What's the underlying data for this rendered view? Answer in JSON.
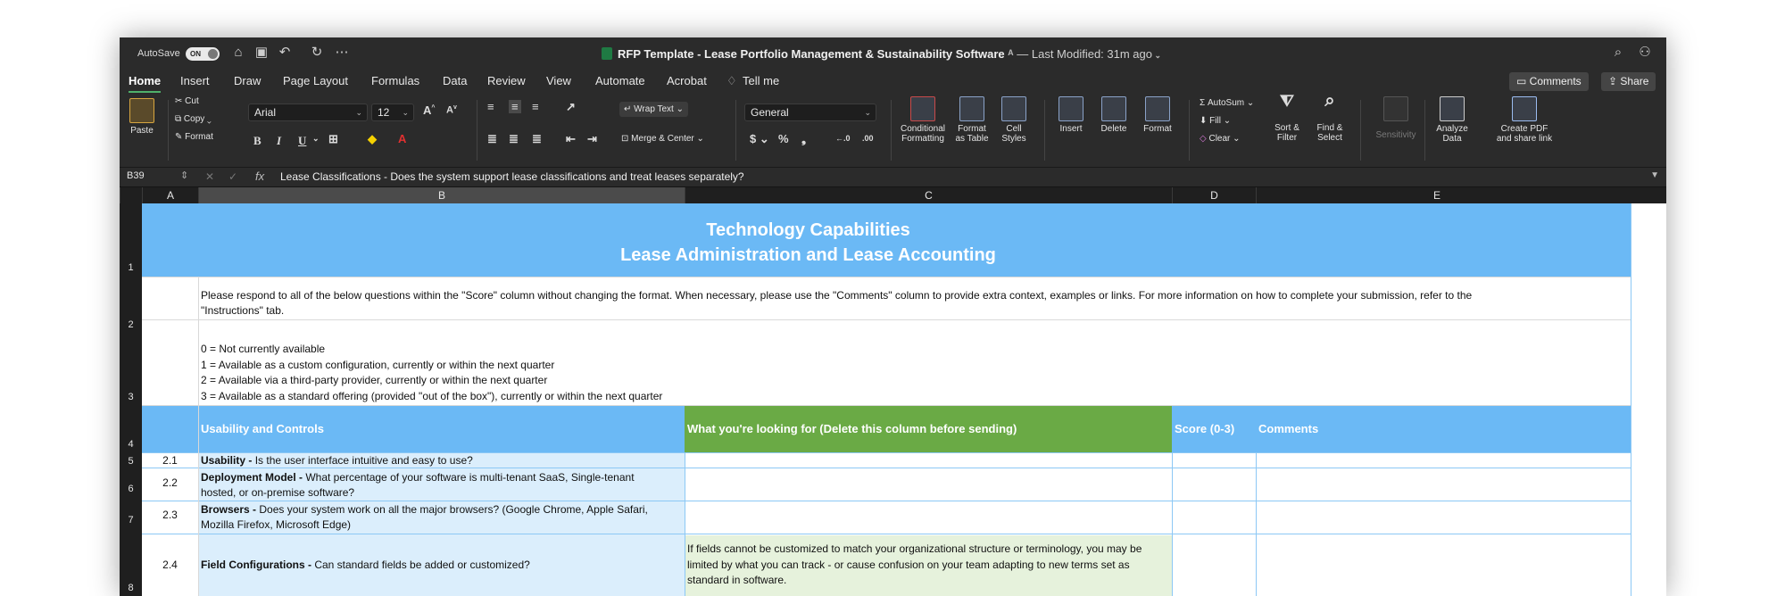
{
  "titlebar": {
    "autosave_label": "AutoSave",
    "autosave_state": "ON",
    "doc_title": "RFP Template - Lease Portfolio Management & Sustainability Software",
    "last_modified": "— Last Modified: 31m ago"
  },
  "menu": {
    "items": [
      "Home",
      "Insert",
      "Draw",
      "Page Layout",
      "Formulas",
      "Data",
      "Review",
      "View",
      "Automate",
      "Acrobat",
      "Tell me"
    ],
    "comments_label": "Comments",
    "share_label": "Share"
  },
  "ribbon": {
    "paste": "Paste",
    "cut": "Cut",
    "copy": "Copy",
    "format_painter": "Format",
    "font_name": "Arial",
    "font_size": "12",
    "wrap_text": "Wrap Text",
    "merge_center": "Merge & Center",
    "number_format": "General",
    "conditional_formatting": [
      "Conditional",
      "Formatting"
    ],
    "format_as_table": [
      "Format",
      "as Table"
    ],
    "cell_styles": [
      "Cell",
      "Styles"
    ],
    "insert": "Insert",
    "delete": "Delete",
    "format": "Format",
    "autosum": "AutoSum",
    "fill": "Fill",
    "clear": "Clear",
    "sort_filter": [
      "Sort &",
      "Filter"
    ],
    "find_select": [
      "Find &",
      "Select"
    ],
    "sensitivity": "Sensitivity",
    "analyze_data": [
      "Analyze",
      "Data"
    ],
    "create_pdf": [
      "Create PDF",
      "and share link"
    ]
  },
  "formula_bar": {
    "name_box": "B39",
    "fx": "fx",
    "formula": "Lease Classifications - Does the system support lease classifications and treat leases separately?"
  },
  "columns": [
    "A",
    "B",
    "C",
    "D",
    "E"
  ],
  "rows": [
    "1",
    "2",
    "3",
    "4",
    "5",
    "6",
    "7",
    "8"
  ],
  "sheet": {
    "title_line1": "Technology Capabilities",
    "title_line2": "Lease Administration and Lease Accounting",
    "instructions_line1": "Please respond to all of the below questions within the \"Score\" column without changing the format. When necessary, please use the \"Comments\" column to provide extra context, examples or links. For more information on how to complete your submission, refer to the",
    "instructions_line2": "\"Instructions\" tab.",
    "scale": [
      "0 = Not currently available",
      "1 = Available as a custom configuration, currently or within the next quarter",
      "2 = Available via a third-party provider, currently or within the next quarter",
      "3 = Available as a standard offering (provided \"out of the box\"), currently or within the next quarter"
    ],
    "headers": {
      "section": "Usability and Controls",
      "looking_for": "What you're looking for (Delete this column before sending)",
      "score": "Score (0-3)",
      "comments": "Comments"
    },
    "items": [
      {
        "num": "2.1",
        "bold": "Usability - ",
        "text": "Is the user interface intuitive and easy to use?",
        "look": ""
      },
      {
        "num": "2.2",
        "bold": "Deployment Model - ",
        "text": "What percentage of your software is multi-tenant SaaS, Single-tenant hosted, or on-premise software?",
        "look": ""
      },
      {
        "num": "2.3",
        "bold": "Browsers - ",
        "text": "Does your system work on all the major browsers? (Google Chrome, Apple Safari, Mozilla Firefox, Microsoft Edge)",
        "look": ""
      },
      {
        "num": "2.4",
        "bold": "Field Configurations - ",
        "text": "Can standard fields be added or customized?",
        "look": "If fields cannot be customized to match your organizational structure or terminology, you may be limited by what you can track - or cause confusion on your team adapting to new terms set as standard in software."
      }
    ]
  },
  "colors": {
    "banner_blue": "#6bb9f5",
    "header_green": "#6aaa45",
    "light_blue_cell": "#dbeefc",
    "light_green_cell": "#e6f2dc",
    "excel_green": "#1f7a43"
  }
}
